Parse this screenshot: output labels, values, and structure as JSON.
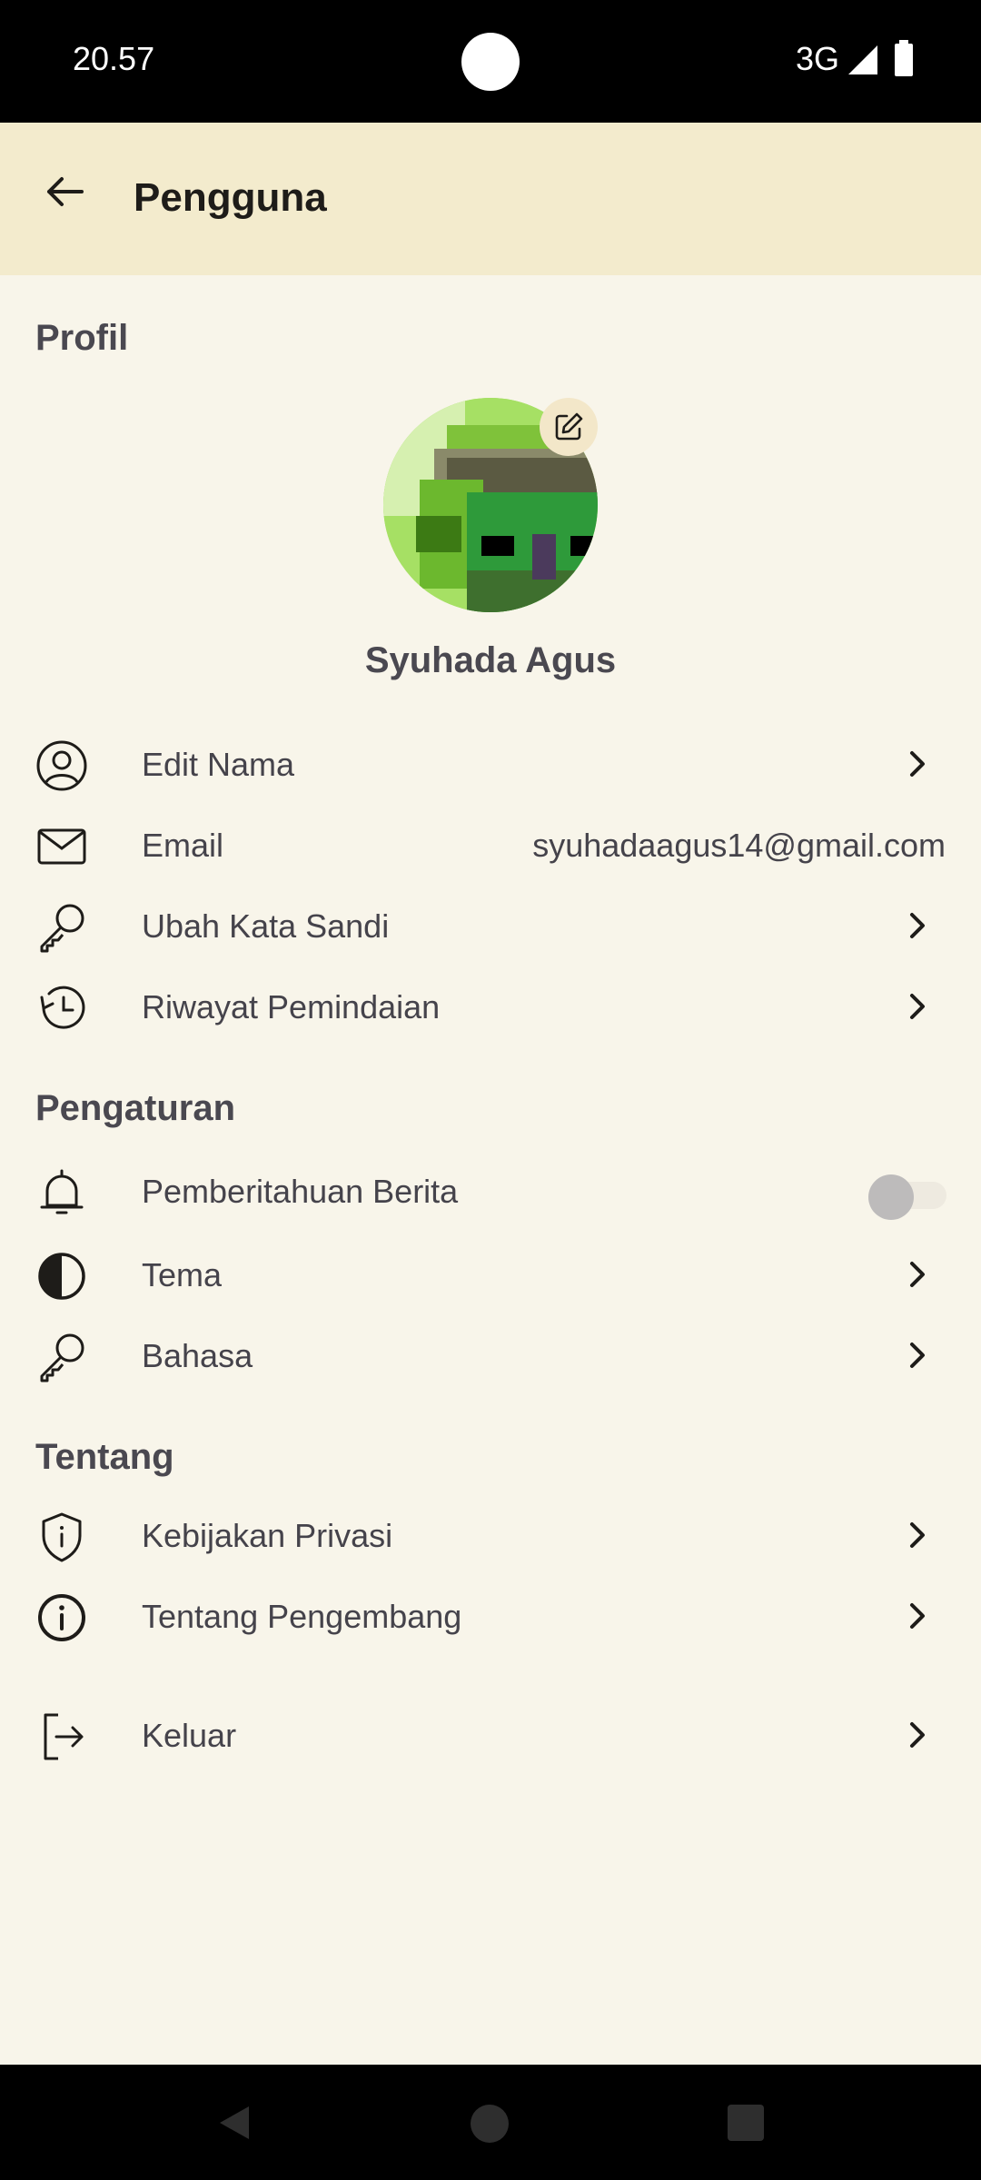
{
  "status_bar": {
    "time": "20.57",
    "network": "3G"
  },
  "app_bar": {
    "title": "Pengguna"
  },
  "sections": {
    "profile": "Profil",
    "settings": "Pengaturan",
    "about": "Tentang"
  },
  "profile": {
    "name": "Syuhada Agus",
    "edit_name": "Edit Nama",
    "email_label": "Email",
    "email_value": "syuhadaagus14@gmail.com",
    "change_password": "Ubah Kata Sandi",
    "scan_history": "Riwayat Pemindaian"
  },
  "settings": {
    "news_notification": "Pemberitahuan Berita",
    "news_notification_enabled": false,
    "theme": "Tema",
    "language": "Bahasa"
  },
  "about": {
    "privacy_policy": "Kebijakan Privasi",
    "about_developer": "Tentang Pengembang"
  },
  "logout": "Keluar",
  "icons": {
    "back": "arrow-left-icon",
    "user": "user-circle-icon",
    "mail": "mail-icon",
    "key": "key-icon",
    "history": "history-icon",
    "bell": "bell-icon",
    "theme": "contrast-icon",
    "info": "info-icon",
    "shield": "shield-icon",
    "logout": "logout-icon",
    "chevron": "chevron-right-icon"
  },
  "colors": {
    "app_bar_bg": "#f3ebcd",
    "content_bg": "#f8f5ea",
    "text": "#45434b"
  }
}
